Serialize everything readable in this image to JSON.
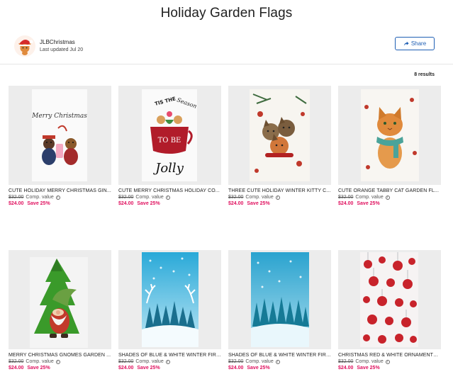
{
  "page": {
    "title": "Holiday Garden Flags"
  },
  "store": {
    "name": "JLBChristmas",
    "updated": "Last updated Jul 20",
    "share_label": "Share"
  },
  "results": {
    "count_label": "8 results"
  },
  "products": [
    {
      "title": "CUTE HOLIDAY MERRY CHRISTMAS GIN...",
      "original_price": "$32.00",
      "comp_label": "Comp. value",
      "sale_price": "$24.00",
      "save_label": "Save 25%",
      "image_icon": "teddy-bears-image",
      "image_text": "Merry Christmas"
    },
    {
      "title": "CUTE MERRY CHRISTMAS HOLIDAY CO...",
      "original_price": "$32.00",
      "comp_label": "Comp. value",
      "sale_price": "$24.00",
      "save_label": "Save 25%",
      "image_icon": "tis-the-season-mug-image",
      "image_text_top": "TIS THE",
      "image_text_script": "Season",
      "image_text_mug": "TO BE",
      "image_text_bottom": "Jolly"
    },
    {
      "title": "THREE CUTE HOLIDAY WINTER KITTY C...",
      "original_price": "$32.00",
      "comp_label": "Comp. value",
      "sale_price": "$24.00",
      "save_label": "Save 25%",
      "image_icon": "three-kittens-image"
    },
    {
      "title": "CUTE ORANGE TABBY CAT GARDEN FL...",
      "original_price": "$32.00",
      "comp_label": "Comp. value",
      "sale_price": "$24.00",
      "save_label": "Save 25%",
      "image_icon": "orange-tabby-cat-image"
    },
    {
      "title": "MERRY CHRISTMAS GNOMES GARDEN ...",
      "original_price": "$32.00",
      "comp_label": "Comp. value",
      "sale_price": "$24.00",
      "save_label": "Save 25%",
      "image_icon": "gnome-tree-image"
    },
    {
      "title": "SHADES OF BLUE & WHITE WINTER FIR ...",
      "original_price": "$32.00",
      "comp_label": "Comp. value",
      "sale_price": "$24.00",
      "save_label": "Save 25%",
      "image_icon": "blue-winter-forest-antlers-image"
    },
    {
      "title": "SHADES OF BLUE & WHITE WINTER FIR ...",
      "original_price": "$32.00",
      "comp_label": "Comp. value",
      "sale_price": "$24.00",
      "save_label": "Save 25%",
      "image_icon": "blue-winter-forest-image"
    },
    {
      "title": "CHRISTMAS RED & WHITE ORNAMENTS ...",
      "original_price": "$32.00",
      "comp_label": "Comp. value",
      "sale_price": "$24.00",
      "save_label": "Save 25%",
      "image_icon": "red-ornaments-image"
    }
  ],
  "colors": {
    "accent": "#1f5fb4",
    "sale": "#e0115f",
    "tile_bg": "#ececec"
  }
}
